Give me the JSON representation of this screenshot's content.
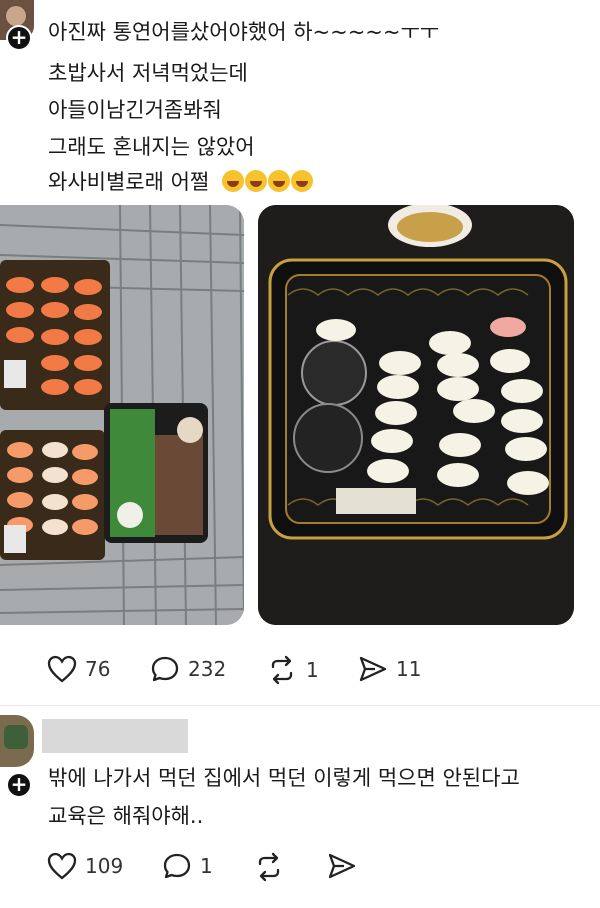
{
  "post": {
    "lines": [
      "아진짜  통연어를샀어야했어  하~~~~~ㅜㅜ",
      "초밥사서  저녁먹었는데",
      "아들이남긴거좀봐줘",
      "그래도 혼내지는 않았어",
      "와사비별로래 어쩔"
    ],
    "emoji": "🤣🤣🤣🤣",
    "likes": "76",
    "comments": "232",
    "reposts": "1",
    "shares": "11"
  },
  "reply": {
    "lines": [
      "밖에 나가서 먹던 집에서 먹던 이렇게 먹으면 안된다고",
      "교육은 해줘야해.."
    ],
    "likes": "109",
    "comments": "1"
  },
  "icons": {
    "like": "heart-icon",
    "comment": "speech-bubble-icon",
    "repost": "repost-arrows-icon",
    "share": "send-icon",
    "follow": "plus-icon"
  }
}
